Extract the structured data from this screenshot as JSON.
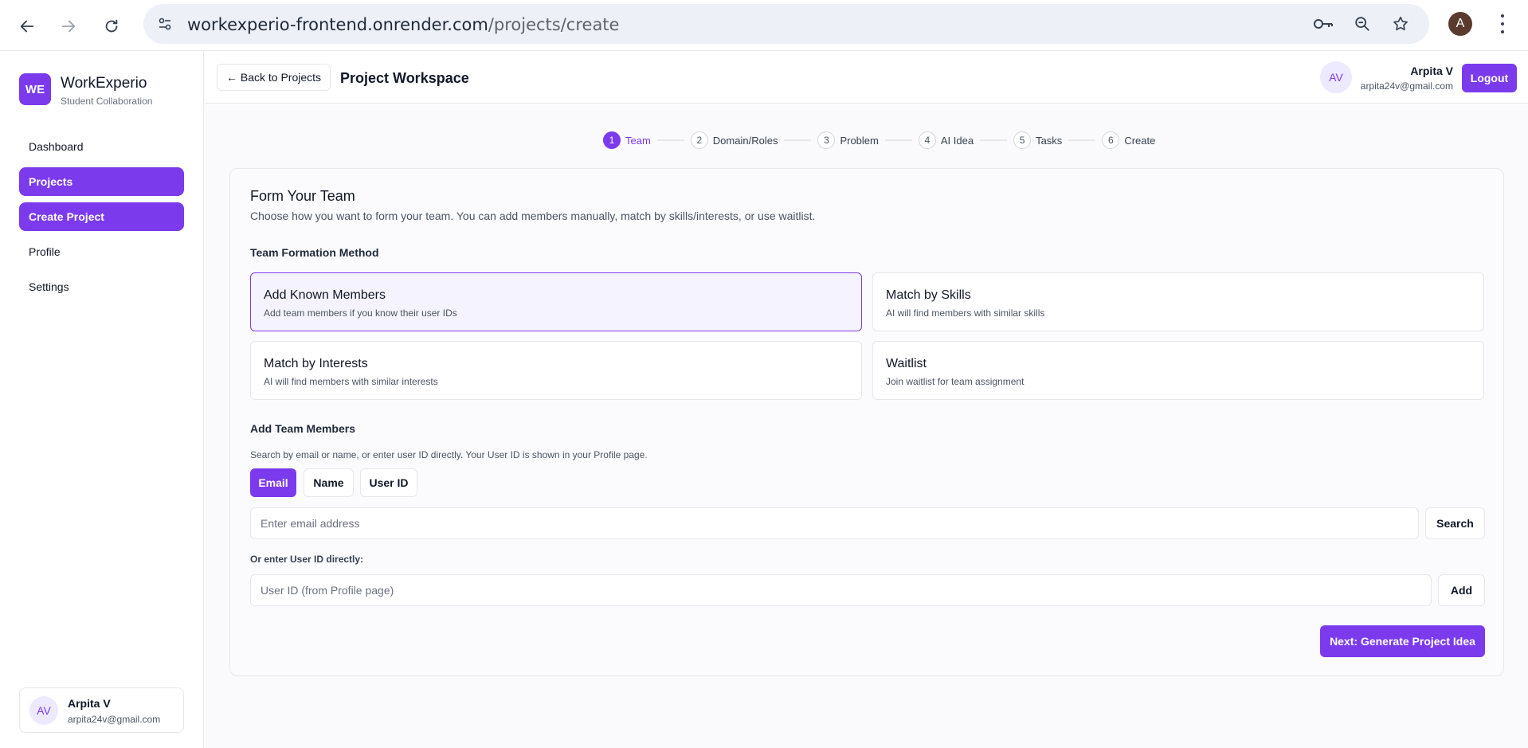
{
  "browser": {
    "url_host": "workexperio-frontend.onrender.com",
    "url_path": "/projects/create",
    "profile_initial": "A"
  },
  "sidebar": {
    "logo_text": "WE",
    "brand_name": "WorkExperio",
    "brand_sub": "Student Collaboration",
    "items": [
      {
        "label": "Dashboard",
        "active": false
      },
      {
        "label": "Projects",
        "active": true
      },
      {
        "label": "Create Project",
        "active": true
      },
      {
        "label": "Profile",
        "active": false
      },
      {
        "label": "Settings",
        "active": false
      }
    ],
    "user": {
      "initials": "AV",
      "name": "Arpita V",
      "email": "arpita24v@gmail.com"
    }
  },
  "header": {
    "back_label": "← Back to Projects",
    "title": "Project Workspace",
    "user": {
      "initials": "AV",
      "name": "Arpita V",
      "email": "arpita24v@gmail.com"
    },
    "logout_label": "Logout"
  },
  "stepper": [
    {
      "num": "1",
      "label": "Team",
      "active": true
    },
    {
      "num": "2",
      "label": "Domain/Roles",
      "active": false
    },
    {
      "num": "3",
      "label": "Problem",
      "active": false
    },
    {
      "num": "4",
      "label": "AI Idea",
      "active": false
    },
    {
      "num": "5",
      "label": "Tasks",
      "active": false
    },
    {
      "num": "6",
      "label": "Create",
      "active": false
    }
  ],
  "form": {
    "title": "Form Your Team",
    "description": "Choose how you want to form your team. You can add members manually, match by skills/interests, or use waitlist.",
    "method_label": "Team Formation Method",
    "options": [
      {
        "title": "Add Known Members",
        "desc": "Add team members if you know their user IDs",
        "selected": true
      },
      {
        "title": "Match by Skills",
        "desc": "AI will find members with similar skills",
        "selected": false
      },
      {
        "title": "Match by Interests",
        "desc": "AI will find members with similar interests",
        "selected": false
      },
      {
        "title": "Waitlist",
        "desc": "Join waitlist for team assignment",
        "selected": false
      }
    ],
    "add_members_label": "Add Team Members",
    "search_note": "Search by email or name, or enter user ID directly. Your User ID is shown in your Profile page.",
    "search_modes": [
      {
        "label": "Email",
        "active": true
      },
      {
        "label": "Name",
        "active": false
      },
      {
        "label": "User ID",
        "active": false
      }
    ],
    "email_placeholder": "Enter email address",
    "search_label": "Search",
    "userid_note": "Or enter User ID directly:",
    "userid_placeholder": "User ID (from Profile page)",
    "add_label": "Add",
    "next_label": "Next: Generate Project Idea"
  },
  "colors": {
    "accent": "#7c3aed",
    "accent_light": "#ede9fe"
  }
}
